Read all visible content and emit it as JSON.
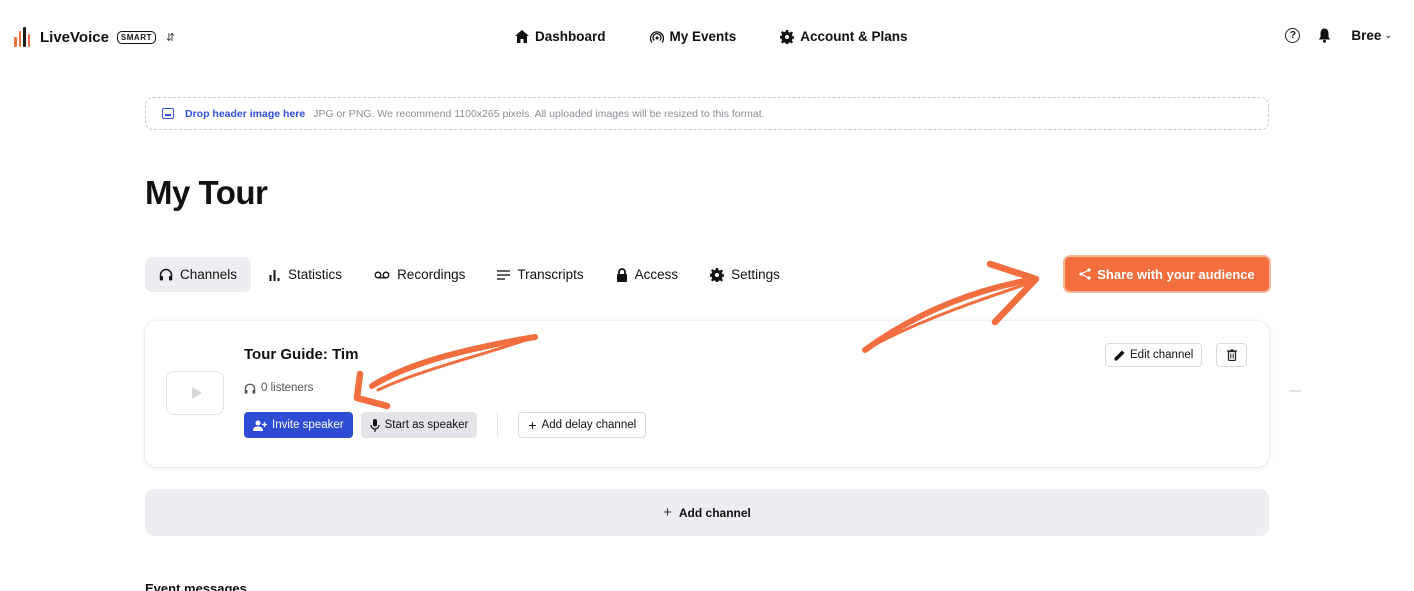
{
  "app": {
    "name": "LiveVoice",
    "plan_badge": "SMART",
    "logo_colors": [
      "#f26e3f",
      "#f26e3f",
      "#1c1c1c",
      "#f26e3f"
    ]
  },
  "nav": {
    "items": [
      {
        "label": "Dashboard",
        "icon": "home-icon"
      },
      {
        "label": "My Events",
        "icon": "broadcast-icon"
      },
      {
        "label": "Account & Plans",
        "icon": "gear-icon"
      }
    ]
  },
  "user": {
    "name": "Bree"
  },
  "dropzone": {
    "cta": "Drop header image here",
    "hint": "JPG or PNG. We recommend 1100x265 pixels. All uploaded images will be resized to this format."
  },
  "page": {
    "title": "My Tour"
  },
  "tabs": [
    {
      "label": "Channels",
      "icon": "headphones-icon",
      "active": true
    },
    {
      "label": "Statistics",
      "icon": "bar-chart-icon"
    },
    {
      "label": "Recordings",
      "icon": "voicemail-icon"
    },
    {
      "label": "Transcripts",
      "icon": "lines-icon"
    },
    {
      "label": "Access",
      "icon": "lock-icon"
    },
    {
      "label": "Settings",
      "icon": "gear-icon"
    }
  ],
  "share": {
    "label": "Share with your audience"
  },
  "channel": {
    "title": "Tour Guide: Tim",
    "listeners": "0 listeners",
    "invite_label": "Invite speaker",
    "start_label": "Start as speaker",
    "delay_label": "Add delay channel",
    "edit_label": "Edit channel"
  },
  "add_channel": {
    "label": "Add channel"
  },
  "sections": {
    "event_messages": "Event messages"
  },
  "colors": {
    "accent": "#f26e3f",
    "primary_blue": "#2d4bd3",
    "annotation_arrow": "#f26e3f"
  }
}
